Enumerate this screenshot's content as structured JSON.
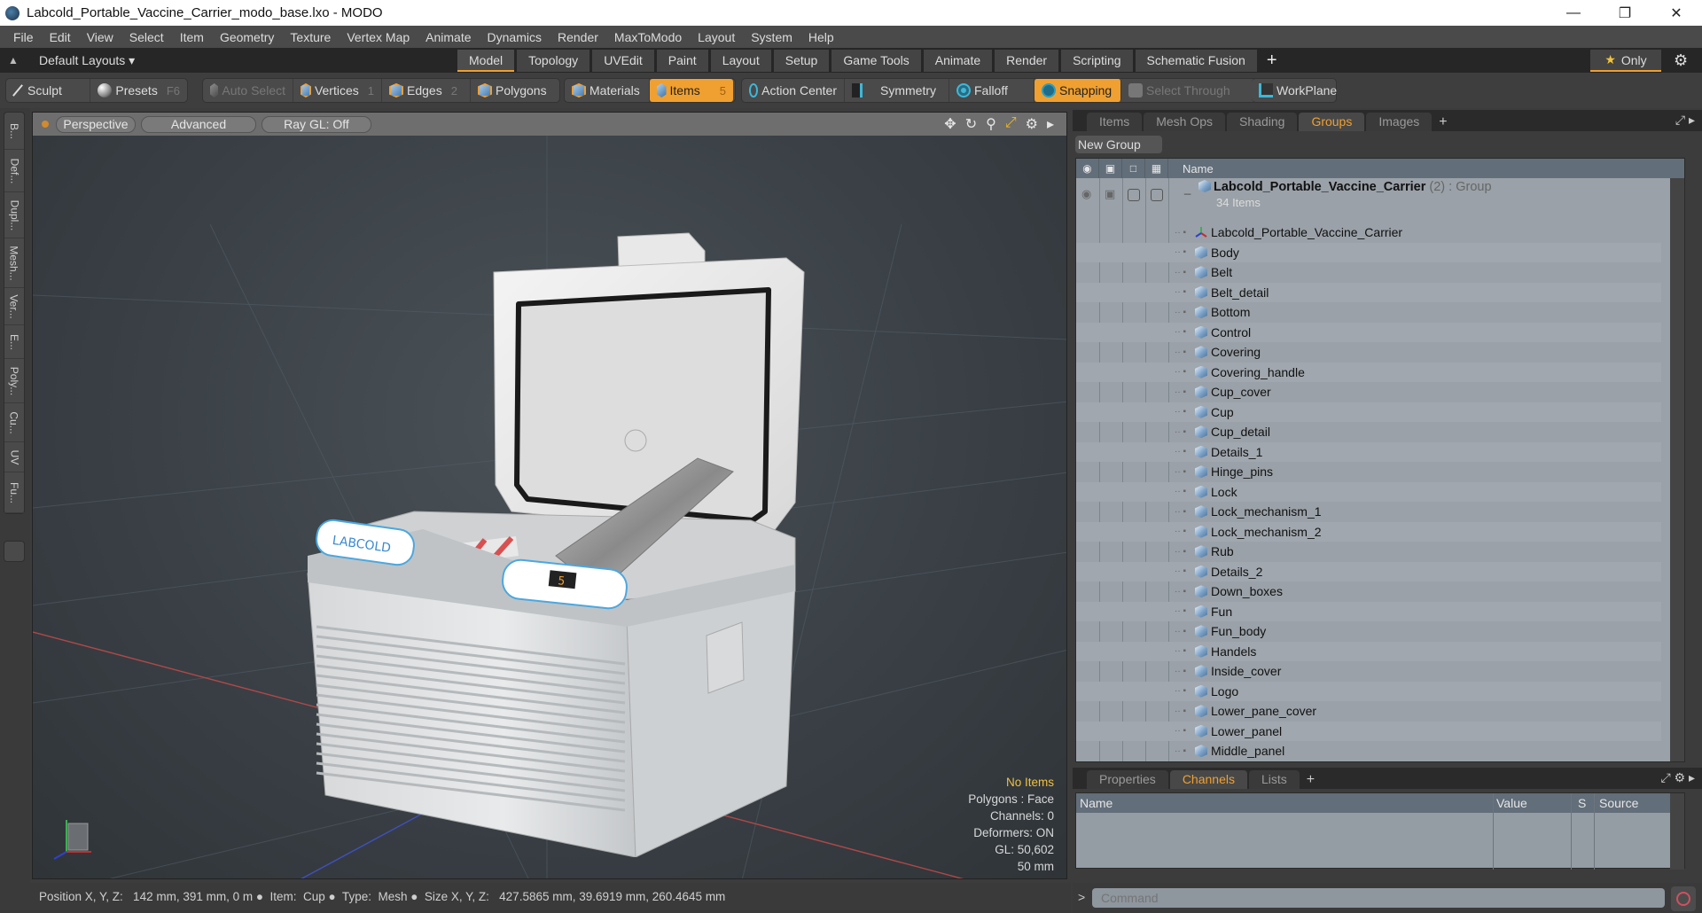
{
  "window": {
    "title": "Labcold_Portable_Vaccine_Carrier_modo_base.lxo - MODO",
    "controls": [
      "minimize",
      "restore",
      "close"
    ]
  },
  "menu": [
    "File",
    "Edit",
    "View",
    "Select",
    "Item",
    "Geometry",
    "Texture",
    "Vertex Map",
    "Animate",
    "Dynamics",
    "Render",
    "MaxToModo",
    "Layout",
    "System",
    "Help"
  ],
  "layouts": {
    "dropdown_label": "Default Layouts ▾",
    "tabs": [
      "Model",
      "Topology",
      "UVEdit",
      "Paint",
      "Layout",
      "Setup",
      "Game Tools",
      "Animate",
      "Render",
      "Scripting",
      "Schematic Fusion"
    ],
    "active_tab": "Model",
    "add_tab": "+",
    "only_label": "Only"
  },
  "toolbar": {
    "sculpt": "Sculpt",
    "presets": "Presets",
    "presets_shortcut": "F6",
    "auto_select": "Auto Select",
    "vertices": "Vertices",
    "vertices_count": "1",
    "edges": "Edges",
    "edges_count": "2",
    "polygons": "Polygons",
    "materials": "Materials",
    "items": "Items",
    "items_count": "5",
    "action_center": "Action Center",
    "symmetry": "Symmetry",
    "falloff": "Falloff",
    "snapping": "Snapping",
    "select_through": "Select Through",
    "workplane": "WorkPlane",
    "accent_color": "#f0a030"
  },
  "left_tabs": [
    "B...",
    "Def...",
    "Dupl...",
    "Mesh...",
    "Ver...",
    "E...",
    "Poly...",
    "Cu...",
    "UV",
    "Fu..."
  ],
  "viewport": {
    "view_mode": "Perspective",
    "shading": "Advanced",
    "raygl": "Ray GL: Off",
    "info": {
      "items": "No Items",
      "polygons": "Polygons : Face",
      "channels": "Channels: 0",
      "deformers": "Deformers: ON",
      "gl": "GL: 50,602",
      "scale": "50 mm"
    },
    "model_label": "LABCOLD",
    "display_digit": "5"
  },
  "groups_panel": {
    "tabs": [
      "Items",
      "Mesh Ops",
      "Shading",
      "Groups",
      "Images"
    ],
    "active_tab": "Groups",
    "new_group": "New Group",
    "column_name": "Name",
    "group": {
      "name": "Labcold_Portable_Vaccine_Carrier",
      "count": "(2)",
      "type": ": Group",
      "subtitle": "34 Items"
    },
    "items": [
      {
        "name": "Labcold_Portable_Vaccine_Carrier",
        "type": "locator"
      },
      {
        "name": "Body",
        "type": "mesh"
      },
      {
        "name": "Belt",
        "type": "mesh"
      },
      {
        "name": "Belt_detail",
        "type": "mesh"
      },
      {
        "name": "Bottom",
        "type": "mesh"
      },
      {
        "name": "Control",
        "type": "mesh"
      },
      {
        "name": "Covering",
        "type": "mesh"
      },
      {
        "name": "Covering_handle",
        "type": "mesh"
      },
      {
        "name": "Cup_cover",
        "type": "mesh"
      },
      {
        "name": "Cup",
        "type": "mesh"
      },
      {
        "name": "Cup_detail",
        "type": "mesh"
      },
      {
        "name": "Details_1",
        "type": "mesh"
      },
      {
        "name": "Hinge_pins",
        "type": "mesh"
      },
      {
        "name": "Lock",
        "type": "mesh"
      },
      {
        "name": "Lock_mechanism_1",
        "type": "mesh"
      },
      {
        "name": "Lock_mechanism_2",
        "type": "mesh"
      },
      {
        "name": "Rub",
        "type": "mesh"
      },
      {
        "name": "Details_2",
        "type": "mesh"
      },
      {
        "name": "Down_boxes",
        "type": "mesh"
      },
      {
        "name": "Fun",
        "type": "mesh"
      },
      {
        "name": "Fun_body",
        "type": "mesh"
      },
      {
        "name": "Handels",
        "type": "mesh"
      },
      {
        "name": "Inside_cover",
        "type": "mesh"
      },
      {
        "name": "Logo",
        "type": "mesh"
      },
      {
        "name": "Lower_pane_cover",
        "type": "mesh"
      },
      {
        "name": "Lower_panel",
        "type": "mesh"
      },
      {
        "name": "Middle_panel",
        "type": "mesh"
      }
    ]
  },
  "channels_panel": {
    "tabs": [
      "Properties",
      "Channels",
      "Lists"
    ],
    "active_tab": "Channels",
    "columns": [
      "Name",
      "Value",
      "S",
      "Source"
    ]
  },
  "command": {
    "prompt": ">",
    "placeholder": "Command"
  },
  "status": {
    "text": "Position X, Y, Z:   142 mm, 391 mm, 0 m ●  Item:  Cup ●  Type:  Mesh ●  Size X, Y, Z:   427.5865 mm, 39.6919 mm, 260.4645 mm"
  }
}
